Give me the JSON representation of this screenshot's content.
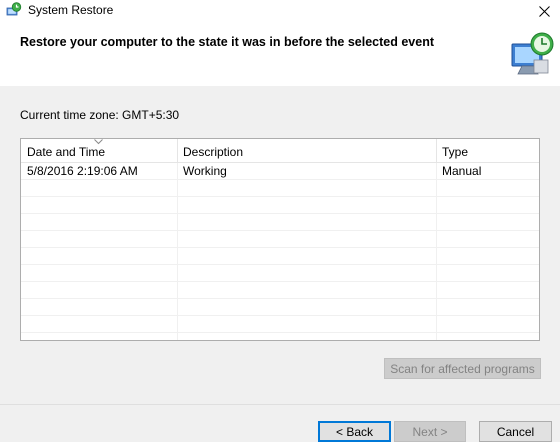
{
  "window": {
    "title": "System Restore",
    "app_icon": "system-restore-icon",
    "close_icon": "close-icon"
  },
  "header": {
    "title": "Restore your computer to the state it was in before the selected event",
    "graphic": "system-restore-graphic"
  },
  "timezone": {
    "label": "Current time zone: GMT+5:30"
  },
  "list": {
    "columns": [
      {
        "label": "Date and Time"
      },
      {
        "label": "Description"
      },
      {
        "label": "Type"
      }
    ],
    "sorted_column": "Date and Time",
    "rows": [
      {
        "date": "5/8/2016 2:19:06 AM",
        "description": "Working",
        "type": "Manual"
      }
    ]
  },
  "buttons": {
    "scan": "Scan for affected programs",
    "back": "< Back",
    "next": "Next >",
    "cancel": "Cancel"
  },
  "colors": {
    "content_bg": "#f0f0f0",
    "focus_blue": "#0078d7"
  }
}
